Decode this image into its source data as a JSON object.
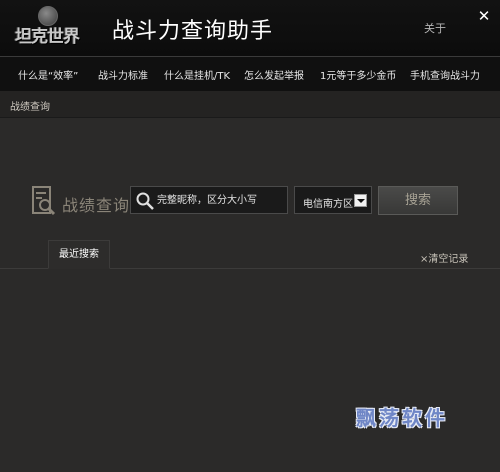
{
  "app": {
    "logo_text": "坦克世界",
    "title": "战斗力查询助手",
    "about_label": "关于",
    "close_symbol": "✕"
  },
  "nav": {
    "items": [
      {
        "label": "什么是“效率”"
      },
      {
        "label": "战斗力标准"
      },
      {
        "label": "什么是挂机/TK"
      },
      {
        "label": "怎么发起举报"
      },
      {
        "label": "1元等于多少金币"
      },
      {
        "label": "手机查询战斗力"
      }
    ]
  },
  "breadcrumb": {
    "current": "战绩查询"
  },
  "search": {
    "section_title": "战绩查询",
    "input_value": "",
    "input_placeholder": "完整昵称，区分大小写",
    "server_selected": "电信南方区",
    "button_label": "搜索"
  },
  "records": {
    "tab_label": "最近搜索",
    "clear_label": "×清空记录",
    "items": []
  },
  "watermark": {
    "text": "飘荡软件",
    "color": "#6f86c6"
  },
  "colors": {
    "background": "#2b2a29",
    "titlebar": "#0c0c0c",
    "navbar": "#101010",
    "muted_title": "#8a8478"
  }
}
